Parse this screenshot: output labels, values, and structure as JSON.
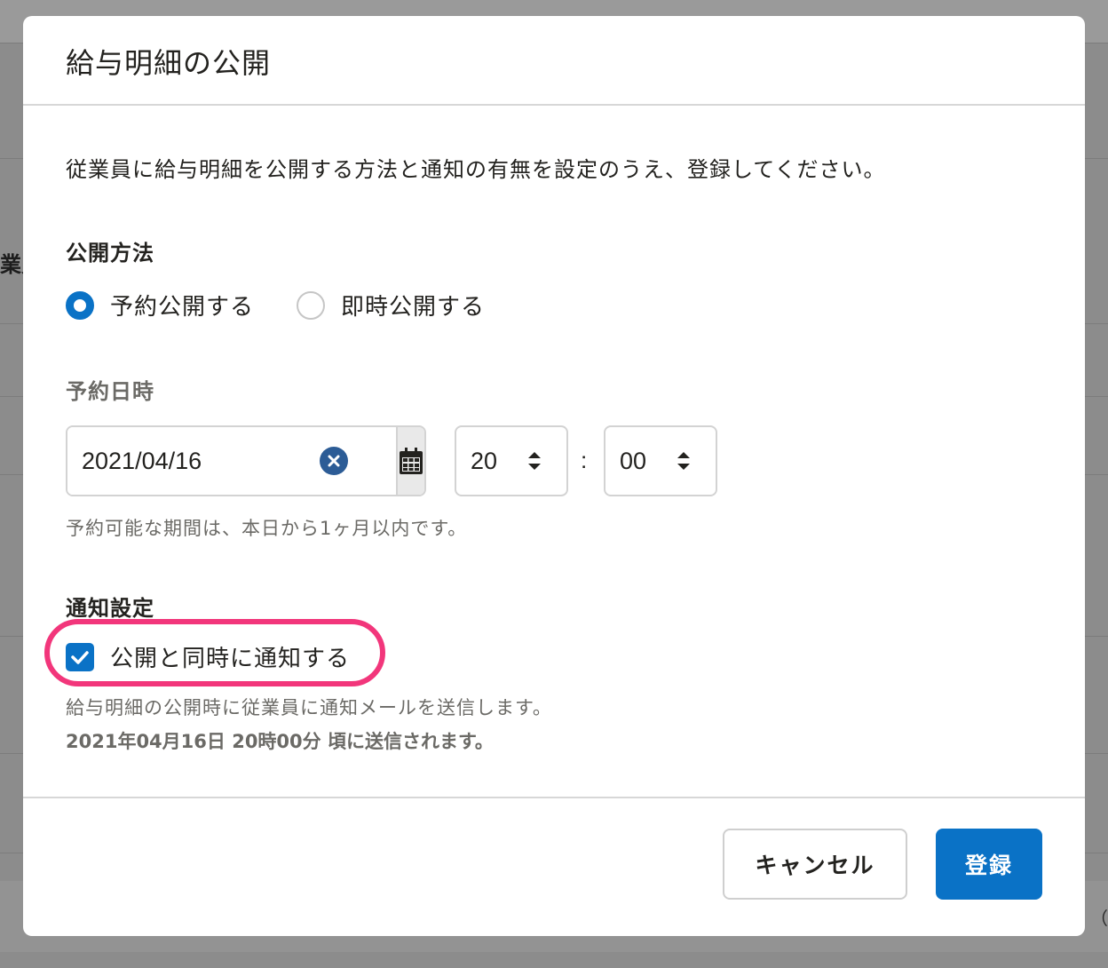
{
  "background": {
    "left_edge_text": "業員",
    "right_edge_text": "（"
  },
  "dialog": {
    "title": "給与明細の公開",
    "description": "従業員に給与明細を公開する方法と通知の有無を設定のうえ、登録してください。",
    "publish_method": {
      "label": "公開方法",
      "options": [
        {
          "label": "予約公開する",
          "checked": true
        },
        {
          "label": "即時公開する",
          "checked": false
        }
      ]
    },
    "schedule": {
      "label": "予約日時",
      "date_value": "2021/04/16",
      "hour_value": "20",
      "minute_value": "00",
      "separator": ":",
      "hint": "予約可能な期間は、本日から1ヶ月以内です。"
    },
    "notification": {
      "label": "通知設定",
      "checkbox_label": "公開と同時に通知する",
      "checked": true,
      "note": "給与明細の公開時に従業員に通知メールを送信します。",
      "send_time_note": "2021年04月16日 20時00分 頃に送信されます。"
    },
    "footer": {
      "cancel_label": "キャンセル",
      "submit_label": "登録"
    }
  },
  "colors": {
    "primary": "#0a72c6",
    "highlight": "#f2367b",
    "overlay": "#8c8c8c"
  }
}
